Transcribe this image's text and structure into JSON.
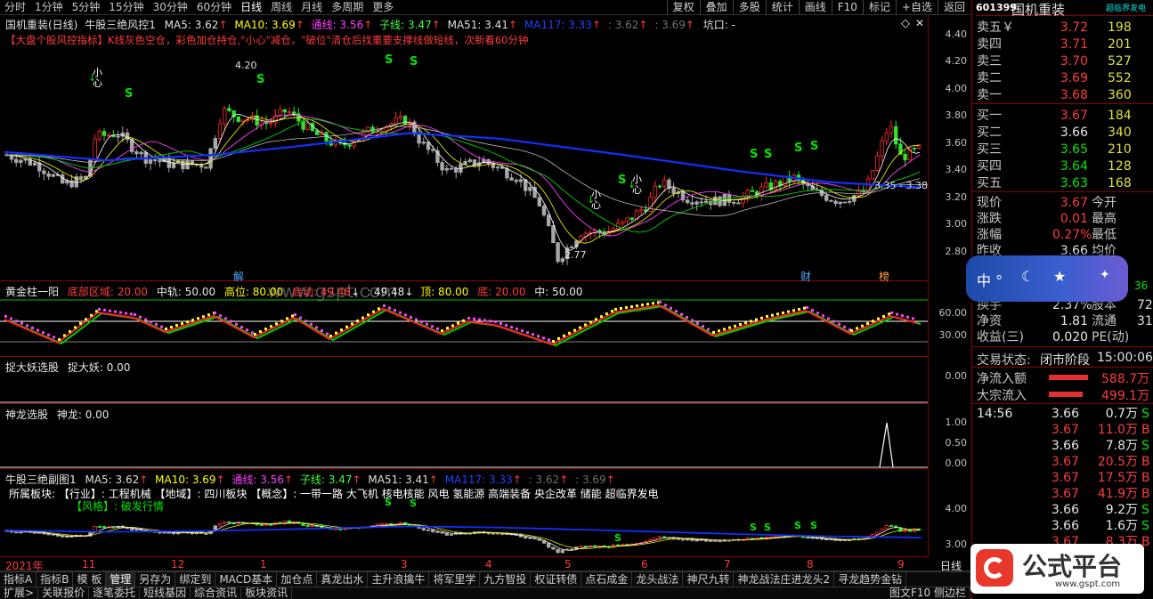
{
  "period_bar": {
    "items": [
      "分时",
      "1分钟",
      "5分钟",
      "15分钟",
      "30分钟",
      "60分钟",
      "日线",
      "周线",
      "月线",
      "多周期",
      "更多"
    ],
    "active": "日线",
    "tools": [
      "复权",
      "叠加",
      "多股",
      "统计",
      "画线",
      "F10",
      "标记",
      "+自选",
      "返回"
    ]
  },
  "main_chart": {
    "header": {
      "stock": "国机重装(日线)",
      "indicator": "牛股三绝风控1",
      "ma5": "MA5: 3.62",
      "ma10": "MA10: 3.69",
      "tongxian": "通线: 3.56",
      "zixian": "子线: 3.47",
      "ma51": "MA51: 3.41",
      "ma117": "MA117: 3.33",
      "v1": ": 3.62",
      "v2": ": 3.69",
      "kengkou": "坑口: -"
    },
    "notice": "【大盘个股风控指标】K线灰色空仓，彩色加仓持仓,\"小心\"减仓，\"破位\"清仓后找重要支撑线做短线，次新看60分钟",
    "y_ticks": [
      "4.40",
      "4.20",
      "4.00",
      "3.80",
      "3.60",
      "3.40",
      "3.20",
      "3.00",
      "2.80"
    ],
    "annotations": {
      "high": "4.20",
      "low": "2.77",
      "range": "3.35 - 3.38",
      "xin": "小\n心",
      "s": "S"
    },
    "markers": [
      "解",
      "财",
      "榜"
    ],
    "watermark": "www.gspt.com"
  },
  "golden_panel": {
    "name": "黄金柱一阳",
    "d1": "底部区域: 20.00",
    "d2": "中轨: 50.00",
    "d3": "高位: 80.00",
    "d4": "启动: 49.48",
    "d5": ": 49.48",
    "d6": "顶: 80.00",
    "d7": "底: 20.00",
    "d8": "中: 50.00",
    "y_ticks": [
      "60.00",
      "30.00"
    ]
  },
  "catch_panel": {
    "name": "捉大妖选股",
    "value": "捉大妖: 0.00",
    "y_tick": "0.00"
  },
  "dragon_panel": {
    "name": "神龙选股",
    "value": "神龙: 0.00",
    "y_ticks": [
      "1.00",
      "0.50",
      "0.00"
    ]
  },
  "sub_panel": {
    "name": "牛股三绝副图1",
    "ma5": "MA5: 3.62",
    "ma10": "MA10: 3.69",
    "tongxian": "通线: 3.56",
    "zixian": "子线: 3.47",
    "ma51": "MA51: 3.41",
    "ma117": "MA117: 3.33",
    "v1": ": 3.62",
    "v2": ": 3.69",
    "sector": "所属板块:  【行业】: 工程机械  【地域】: 四川板块  【概念】: 一带一路 大飞机 核电核能 风电 氢能源 高端装备 央企改革 储能 超临界发电",
    "style": "【风格】: 破发行情",
    "y_ticks": [
      "4.00",
      "3.00"
    ]
  },
  "time_axis": {
    "labels": [
      "2021年",
      "11",
      "12",
      "1",
      "3",
      "4",
      "5",
      "6",
      "7",
      "8",
      "9"
    ],
    "period": "日线"
  },
  "tabs_row1": [
    "指标A",
    "指标B",
    "模 板",
    "管理",
    "另存为",
    "绑定到",
    "MACD基本",
    "加仓点",
    "真龙出水",
    "主升浪擒牛",
    "将军里学",
    "九方智投",
    "权证转债",
    "点石成金",
    "龙头战法",
    "神尺九转",
    "神龙战法庄进龙头2",
    "寻龙趋势金钻"
  ],
  "tabs_row1_active": "管理",
  "tabs_row2": [
    "扩展>",
    "关联报价",
    "逐笔委托",
    "短线基因",
    "综合资讯",
    "板块资讯"
  ],
  "tabs_row2_right": "图文F10 侧边栏",
  "quote": {
    "code": "601399",
    "name": "国机重装",
    "tag": "超临界发电",
    "sells": [
      {
        "label": "卖五￥",
        "price": "3.72",
        "vol": "198"
      },
      {
        "label": "卖四",
        "price": "3.71",
        "vol": "201"
      },
      {
        "label": "卖三",
        "price": "3.70",
        "vol": "527"
      },
      {
        "label": "卖二",
        "price": "3.69",
        "vol": "552"
      },
      {
        "label": "卖一",
        "price": "3.68",
        "vol": "360"
      }
    ],
    "buys": [
      {
        "label": "买一",
        "price": "3.67",
        "vol": "184"
      },
      {
        "label": "买二",
        "price": "3.66",
        "vol": "340"
      },
      {
        "label": "买三",
        "price": "3.65",
        "vol": "210"
      },
      {
        "label": "买四",
        "price": "3.64",
        "vol": "128"
      },
      {
        "label": "买五",
        "price": "3.63",
        "vol": "168"
      }
    ],
    "stats": [
      {
        "label": "现价",
        "value": "3.67",
        "label2": "今开"
      },
      {
        "label": "涨跌",
        "value": "0.01",
        "label2": "最高"
      },
      {
        "label": "涨幅",
        "value": "0.27%",
        "label2": "最低"
      },
      {
        "label": "昨收",
        "value": "3.66",
        "label2": "均价"
      }
    ],
    "stats2": [
      {
        "label": "换手",
        "value": "2.37%",
        "label2": "股本",
        "extra": "72"
      },
      {
        "label": "净资",
        "value": "1.81",
        "label2": "流通",
        "extra": "31"
      },
      {
        "label": "收益(三)",
        "value": "0.020",
        "label2": "PE(动)",
        "extra": ""
      }
    ],
    "extra_36": "36",
    "status_label": "交易状态:",
    "status": "闭市阶段",
    "status_time": "15:00:06",
    "net_inflow_label": "净流入额",
    "net_inflow": "588.7万",
    "block_inflow_label": "大宗流入",
    "block_inflow": "499.1万",
    "ticks": [
      {
        "time": "14:56",
        "price": "3.66",
        "vol": "0.7万",
        "side": "S"
      },
      {
        "time": "",
        "price": "3.67",
        "vol": "11.0万",
        "side": "B"
      },
      {
        "time": "",
        "price": "3.66",
        "vol": "7.8万",
        "side": "S"
      },
      {
        "time": "",
        "price": "3.67",
        "vol": "20.5万",
        "side": "B"
      },
      {
        "time": "",
        "price": "3.67",
        "vol": "17.5万",
        "side": "B"
      },
      {
        "time": "",
        "price": "3.67",
        "vol": "41.9万",
        "side": "B"
      },
      {
        "time": "",
        "price": "3.66",
        "vol": "9.2万",
        "side": "S"
      },
      {
        "time": "",
        "price": "3.66",
        "vol": "1.6万",
        "side": "S"
      },
      {
        "time": "",
        "price": "3.67",
        "vol": "8.3万",
        "side": "B"
      }
    ]
  },
  "weather": {
    "text": "中 °"
  },
  "logo": {
    "text": "公式平台",
    "url": "www.gspt.com"
  },
  "colors": {
    "up": "#ff3b3b",
    "down": "#00e600",
    "ma117": "#1030ff",
    "bg": "#000000",
    "frame": "#8b0000"
  }
}
